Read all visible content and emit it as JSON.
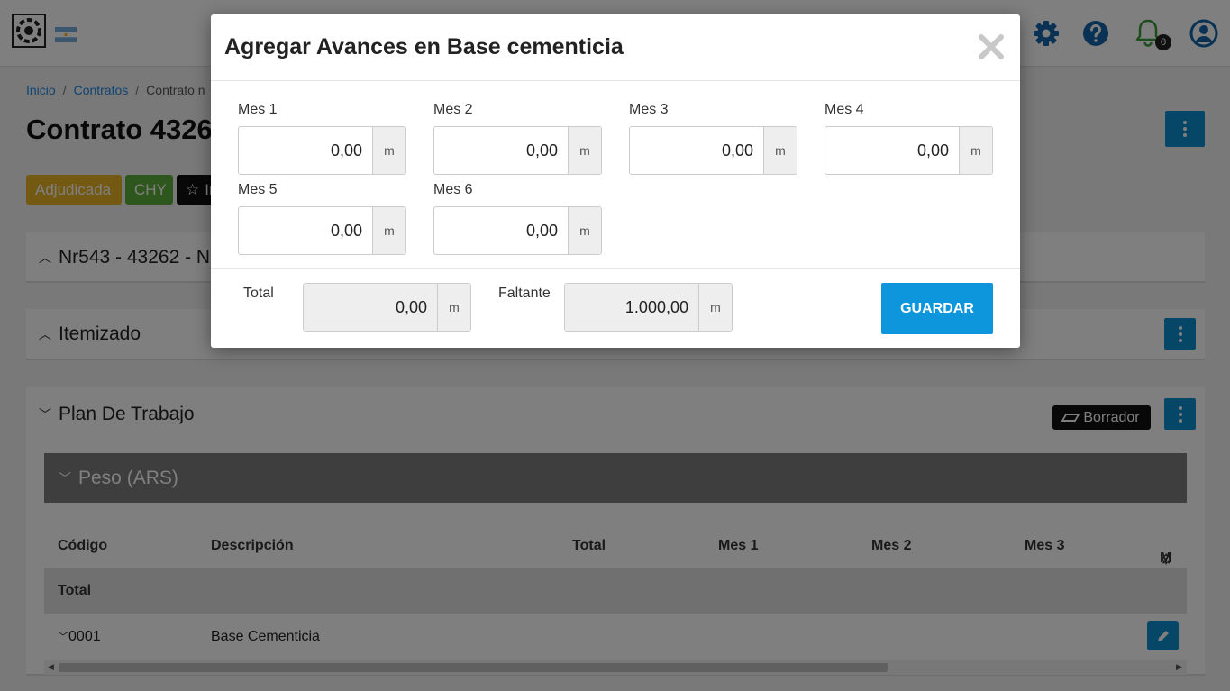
{
  "header": {
    "icons": [
      "logo-icon",
      "argentina-flag-icon",
      "gear-icon",
      "help-icon",
      "bell-icon",
      "user-icon"
    ],
    "notification_count": "0"
  },
  "breadcrumb": {
    "items": [
      "Inicio",
      "Contratos",
      "Contrato n"
    ]
  },
  "page": {
    "title": "Contrato 4326",
    "badges": [
      {
        "label": "Adjudicada",
        "color": "#e6b224"
      },
      {
        "label": "CHY",
        "color": "#5cae3d"
      },
      {
        "label": "In",
        "color": "#111111"
      }
    ]
  },
  "sections": {
    "contract_panel_title": "Nr543 - 43262 - N",
    "itemizado_title": "Itemizado",
    "plan_title": "Plan De Trabajo",
    "borrador_label": "Borrador",
    "peso_title": "Peso (ARS)"
  },
  "table": {
    "columns": [
      "Código",
      "Descripción",
      "Total",
      "Mes 1",
      "Mes 2",
      "Mes 3",
      "M"
    ],
    "total_label": "Total",
    "rows": [
      {
        "code": "0001",
        "description": "Base Cementicia"
      }
    ]
  },
  "modal": {
    "title": "Agregar Avances en Base cementicia",
    "fields": [
      {
        "label": "Mes 1",
        "value": "0,00",
        "unit": "m"
      },
      {
        "label": "Mes 2",
        "value": "0,00",
        "unit": "m"
      },
      {
        "label": "Mes 3",
        "value": "0,00",
        "unit": "m"
      },
      {
        "label": "Mes 4",
        "value": "0,00",
        "unit": "m"
      },
      {
        "label": "Mes 5",
        "value": "0,00",
        "unit": "m"
      },
      {
        "label": "Mes 6",
        "value": "0,00",
        "unit": "m"
      }
    ],
    "total": {
      "label": "Total",
      "value": "0,00",
      "unit": "m"
    },
    "faltante": {
      "label": "Faltante",
      "value": "1.000,00",
      "unit": "m"
    },
    "save_label": "GUARDAR"
  },
  "colors": {
    "primary": "#0d8fd1",
    "adjudicada": "#e6b224",
    "chy": "#5cae3d"
  }
}
